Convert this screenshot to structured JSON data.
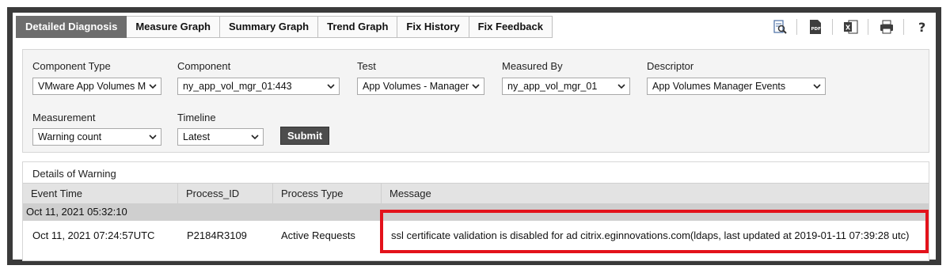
{
  "tabs": [
    {
      "label": "Detailed Diagnosis",
      "active": true
    },
    {
      "label": "Measure Graph"
    },
    {
      "label": "Summary Graph"
    },
    {
      "label": "Trend Graph"
    },
    {
      "label": "Fix History"
    },
    {
      "label": "Fix Feedback"
    }
  ],
  "toolbar_icons": [
    "search-document-icon",
    "pdf-icon",
    "excel-icon",
    "print-icon",
    "help-icon"
  ],
  "filters": {
    "component_type": {
      "label": "Component Type",
      "value": "VMware App Volumes M"
    },
    "component": {
      "label": "Component",
      "value": "ny_app_vol_mgr_01:443"
    },
    "test": {
      "label": "Test",
      "value": "App Volumes - Manager"
    },
    "measured_by": {
      "label": "Measured By",
      "value": "ny_app_vol_mgr_01"
    },
    "descriptor": {
      "label": "Descriptor",
      "value": "App Volumes Manager Events"
    },
    "measurement": {
      "label": "Measurement",
      "value": "Warning count"
    },
    "timeline": {
      "label": "Timeline",
      "value": "Latest"
    },
    "submit_label": "Submit"
  },
  "details": {
    "title": "Details of Warning",
    "columns": [
      "Event Time",
      "Process_ID",
      "Process Type",
      "Message"
    ],
    "group_label": "Oct 11, 2021 05:32:10",
    "rows": [
      {
        "event_time": "Oct 11, 2021 07:24:57UTC",
        "process_id": "P2184R3109",
        "process_type": "Active Requests",
        "message": "ssl certificate validation is disabled for ad citrix.eginnovations.com(ldaps, last updated at 2019-01-11 07:39:28 utc)"
      }
    ]
  },
  "colors": {
    "active_tab": "#6d6d6d",
    "highlight": "#e3121b",
    "frame": "#3a3a3a"
  }
}
